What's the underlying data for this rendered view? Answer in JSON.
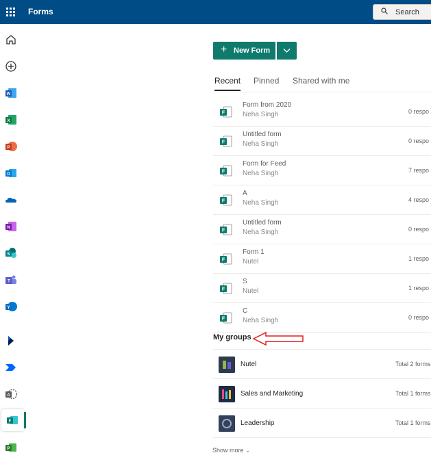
{
  "header": {
    "app_title": "Forms",
    "search_label": "Search",
    "bar_color": "#004c87"
  },
  "rail": {
    "items": [
      {
        "name": "home-icon"
      },
      {
        "name": "create-icon"
      },
      {
        "name": "word-icon",
        "color": "#185abd"
      },
      {
        "name": "excel-icon",
        "color": "#107c41"
      },
      {
        "name": "powerpoint-icon",
        "color": "#c43e1c"
      },
      {
        "name": "outlook-icon",
        "color": "#0078d4"
      },
      {
        "name": "onedrive-icon",
        "color": "#0364b8"
      },
      {
        "name": "onenote-icon",
        "color": "#7719aa"
      },
      {
        "name": "sharepoint-icon",
        "color": "#038387"
      },
      {
        "name": "teams-icon",
        "color": "#5b5fc7"
      },
      {
        "name": "yammer-icon",
        "color": "#106ebe"
      },
      {
        "name": "dynamics-icon",
        "color": "#002050"
      },
      {
        "name": "power-automate-icon",
        "color": "#0066ff"
      },
      {
        "name": "access-icon",
        "color": "#5c5c5c"
      },
      {
        "name": "forms-icon",
        "color": "#0f7b6c",
        "active": true
      },
      {
        "name": "planner-icon",
        "color": "#31752f"
      }
    ]
  },
  "main": {
    "new_form_label": "New Form",
    "accent": "#0f7b6c",
    "tabs": [
      {
        "label": "Recent",
        "active": true
      },
      {
        "label": "Pinned",
        "active": false
      },
      {
        "label": "Shared with me",
        "active": false
      }
    ],
    "forms": [
      {
        "title": "Form from 2020",
        "owner": "Neha Singh",
        "responses": "0 respo"
      },
      {
        "title": "Untitled form",
        "owner": "Neha Singh",
        "responses": "0 respo"
      },
      {
        "title": "Form for Feed",
        "owner": "Neha Singh",
        "responses": "7 respo"
      },
      {
        "title": "A",
        "owner": "Neha Singh",
        "responses": "4 respo"
      },
      {
        "title": "Untitled form",
        "owner": "Neha Singh",
        "responses": "0 respo"
      },
      {
        "title": "Form 1",
        "owner": "Nutel",
        "responses": "1 respo"
      },
      {
        "title": "S",
        "owner": "Nutel",
        "responses": "1 respo"
      },
      {
        "title": "C",
        "owner": "Neha Singh",
        "responses": "0 respo"
      }
    ],
    "groups_heading": "My groups",
    "groups": [
      {
        "name": "Nutel",
        "count": "Total 2 forms"
      },
      {
        "name": "Sales and Marketing",
        "count": "Total 1 forms"
      },
      {
        "name": "Leadership",
        "count": "Total 1 forms"
      }
    ],
    "show_more_label": "Show more"
  }
}
